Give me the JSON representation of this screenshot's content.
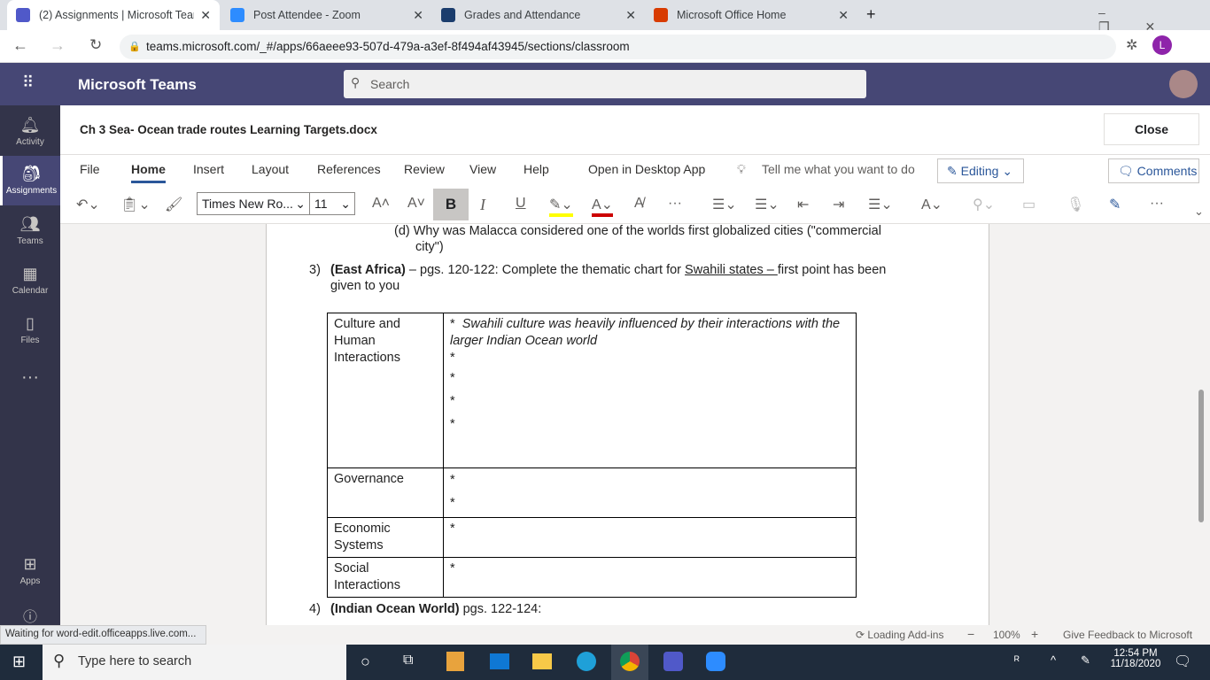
{
  "browser": {
    "tabs": [
      {
        "title": "(2) Assignments | Microsoft Teams",
        "color": "#5059c9"
      },
      {
        "title": "Post Attendee - Zoom",
        "color": "#2d8cff"
      },
      {
        "title": "Grades and Attendance",
        "color": "#1b3d6d"
      },
      {
        "title": "Microsoft Office Home",
        "color": "#d83b01"
      }
    ],
    "url": "teams.microsoft.com/_#/apps/66aeee93-507d-479a-a3ef-8f494af43945/sections/classroom",
    "profile": "L"
  },
  "teams": {
    "title": "Microsoft Teams",
    "search_placeholder": "Search",
    "rail": [
      "Activity",
      "Assignments",
      "Teams",
      "Calendar",
      "Files",
      "Apps"
    ]
  },
  "doc": {
    "filename": "Ch 3 Sea- Ocean trade routes Learning Targets.docx",
    "close": "Close"
  },
  "ribbon": {
    "menus": [
      "File",
      "Home",
      "Insert",
      "Layout",
      "References",
      "Review",
      "View",
      "Help",
      "Open in Desktop App"
    ],
    "tell_me": "Tell me what you want to do",
    "editing": "Editing",
    "comments": "Comments",
    "font": "Times New Ro...",
    "size": "11"
  },
  "content": {
    "q_d_line1": "(d) Why was Malacca considered one of the worlds first globalized cities (\"commercial",
    "q_d_line2": "city\")",
    "q3_num": "3)",
    "q3_bold": "(East Africa)",
    "q3_text1": " – pgs. 120-122:  Complete the thematic chart for ",
    "q3_underline": "Swahili states – ",
    "q3_text2": "first point has been",
    "q3_text3": "given to you",
    "rows": [
      {
        "label": "Culture and Human Interactions",
        "first": "Swahili culture was heavily influenced by their interactions with the larger Indian Ocean world",
        "bullets": 4
      },
      {
        "label": "Governance",
        "bullets": 2
      },
      {
        "label": "Economic Systems",
        "bullets": 1
      },
      {
        "label": "Social Interactions",
        "bullets": 1
      }
    ],
    "bullet": "*",
    "q4_num": "4)",
    "q4_bold": "(Indian Ocean World)",
    "q4_text": " pgs. 122-124:"
  },
  "status": {
    "left": "Waiting for word-edit.officeapps.live.com...",
    "addins": "Loading Add-ins",
    "zoom": "100%",
    "feedback": "Give Feedback to Microsoft"
  },
  "taskbar": {
    "search": "Type here to search",
    "time": "12:54 PM",
    "date": "11/18/2020"
  }
}
